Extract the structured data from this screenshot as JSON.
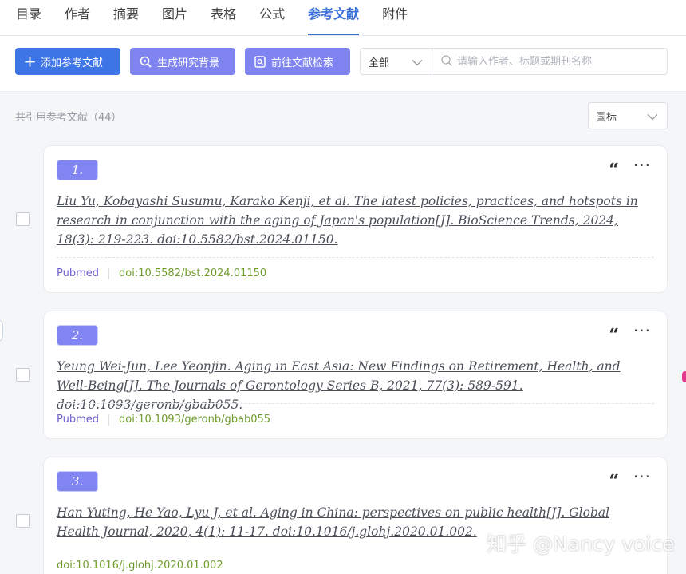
{
  "tabs": [
    {
      "label": "目录"
    },
    {
      "label": "作者"
    },
    {
      "label": "摘要"
    },
    {
      "label": "图片"
    },
    {
      "label": "表格"
    },
    {
      "label": "公式"
    },
    {
      "label": "参考文献",
      "active": true
    },
    {
      "label": "附件"
    }
  ],
  "toolbar": {
    "add_label": "添加参考文献",
    "generate_label": "生成研究背景",
    "goto_label": "前往文献检索",
    "filter_value": "全部",
    "search_placeholder": "请输入作者、标题或期刊名称"
  },
  "summary": {
    "count_text": "共引用参考文献（44）",
    "standard_value": "国标"
  },
  "references": [
    {
      "index": "1.",
      "text": "Liu Yu, Kobayashi Susumu, Karako Kenji, et al. The latest policies, practices, and hotspots in research in conjunction with the aging of Japan's population[J]. BioScience Trends, 2024, 18(3): 219-223. doi:10.5582/bst.2024.01150.",
      "source": "Pubmed",
      "doi": "doi:10.5582/bst.2024.01150"
    },
    {
      "index": "2.",
      "text": "Yeung Wei‐Jun, Lee Yeonjin. Aging in East Asia: New Findings on Retirement, Health, and Well-Being[J]. The Journals of Gerontology Series B, 2021, 77(3): 589-591. doi:10.1093/geronb/gbab055.",
      "source": "Pubmed",
      "doi": "doi:10.1093/geronb/gbab055"
    },
    {
      "index": "3.",
      "text": "Han Yuting, He Yao, Lyu J, et al. Aging in China: perspectives on public health[J]. Global Health Journal, 2020, 4(1): 11-17. doi:10.1016/j.glohj.2020.01.002.",
      "source": "",
      "doi": "doi:10.1016/j.glohj.2020.01.002"
    }
  ],
  "icons": {
    "quote": "“",
    "more": "···"
  },
  "watermark": "知乎 @Nancy voice",
  "colors": {
    "primary": "#3d74e6",
    "accent": "#7f84f0",
    "source": "#6c5fcf",
    "doi": "#6f9b2b"
  }
}
